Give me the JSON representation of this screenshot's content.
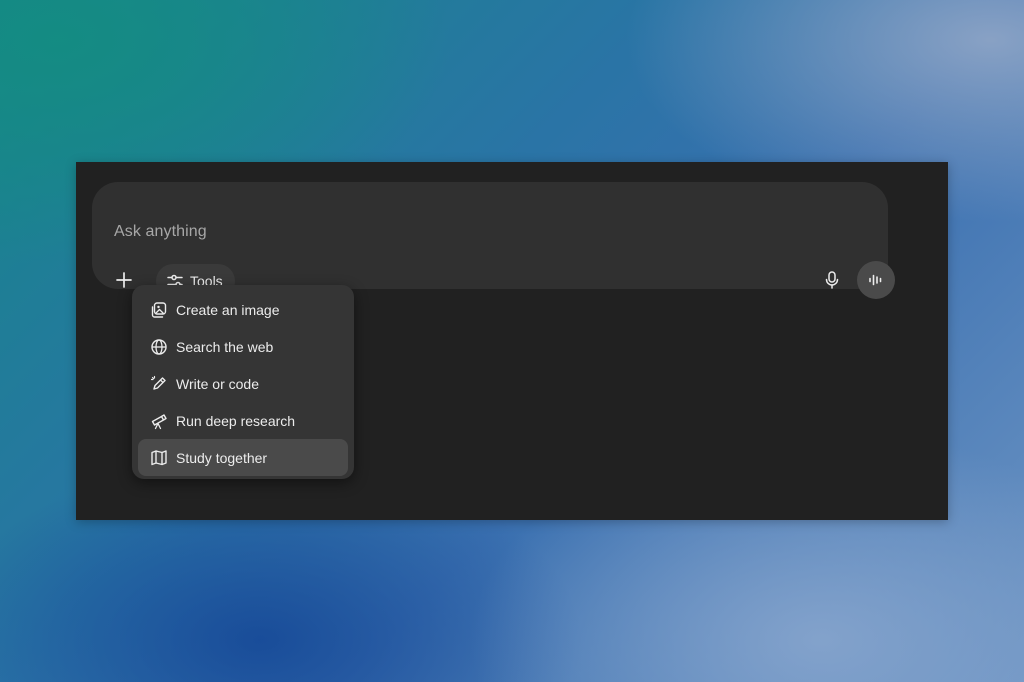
{
  "composer": {
    "placeholder": "Ask anything",
    "tools_label": "Tools",
    "icons": {
      "add": "plus-icon",
      "tools": "sliders-icon",
      "mic": "microphone-icon",
      "voice": "voice-waveform-icon"
    }
  },
  "tools_menu": {
    "items": [
      {
        "label": "Create an image",
        "icon": "image-icon"
      },
      {
        "label": "Search the web",
        "icon": "globe-icon"
      },
      {
        "label": "Write or code",
        "icon": "pen-icon"
      },
      {
        "label": "Run deep research",
        "icon": "telescope-icon"
      },
      {
        "label": "Study together",
        "icon": "book-icon",
        "highlighted": true
      }
    ]
  },
  "colors": {
    "window_bg": "#212121",
    "composer_bg": "#303030",
    "menu_bg": "#353535",
    "highlight_bg": "#4a4a4a",
    "text": "#ececec",
    "placeholder_text": "#a7a7a7"
  }
}
